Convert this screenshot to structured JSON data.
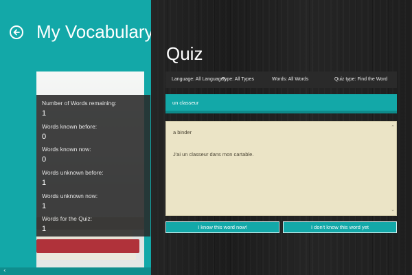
{
  "app": {
    "title": "My Vocabulary"
  },
  "quiz": {
    "title": "Quiz"
  },
  "stats": [
    {
      "label": "Number of Words remaining:",
      "value": "1"
    },
    {
      "label": "Words known before:",
      "value": "0"
    },
    {
      "label": "Words known now:",
      "value": "0"
    },
    {
      "label": "Words unknown before:",
      "value": "1"
    },
    {
      "label": "Words unknown now:",
      "value": "1"
    },
    {
      "label": "Words for the Quiz:",
      "value": "1"
    }
  ],
  "filters": {
    "language": "Language: All Languages",
    "type": "Type: All Types",
    "words": "Words: All Words",
    "quiz_type": "Quiz type: Find the Word"
  },
  "word": "un classeur",
  "answer": {
    "translation": "a binder",
    "example": "J'ai un classeur dans mon cartable."
  },
  "buttons": {
    "known": "I know this word now!",
    "unknown": "I don't know this word yet"
  },
  "colors": {
    "accent": "#13a8a8",
    "answer_bg": "#ebe4c6"
  },
  "icons": {
    "back": "back-arrow-icon",
    "scroll_up": "chevron-up-icon",
    "scroll_down": "chevron-down-icon",
    "scroll_left": "chevron-left-icon"
  }
}
